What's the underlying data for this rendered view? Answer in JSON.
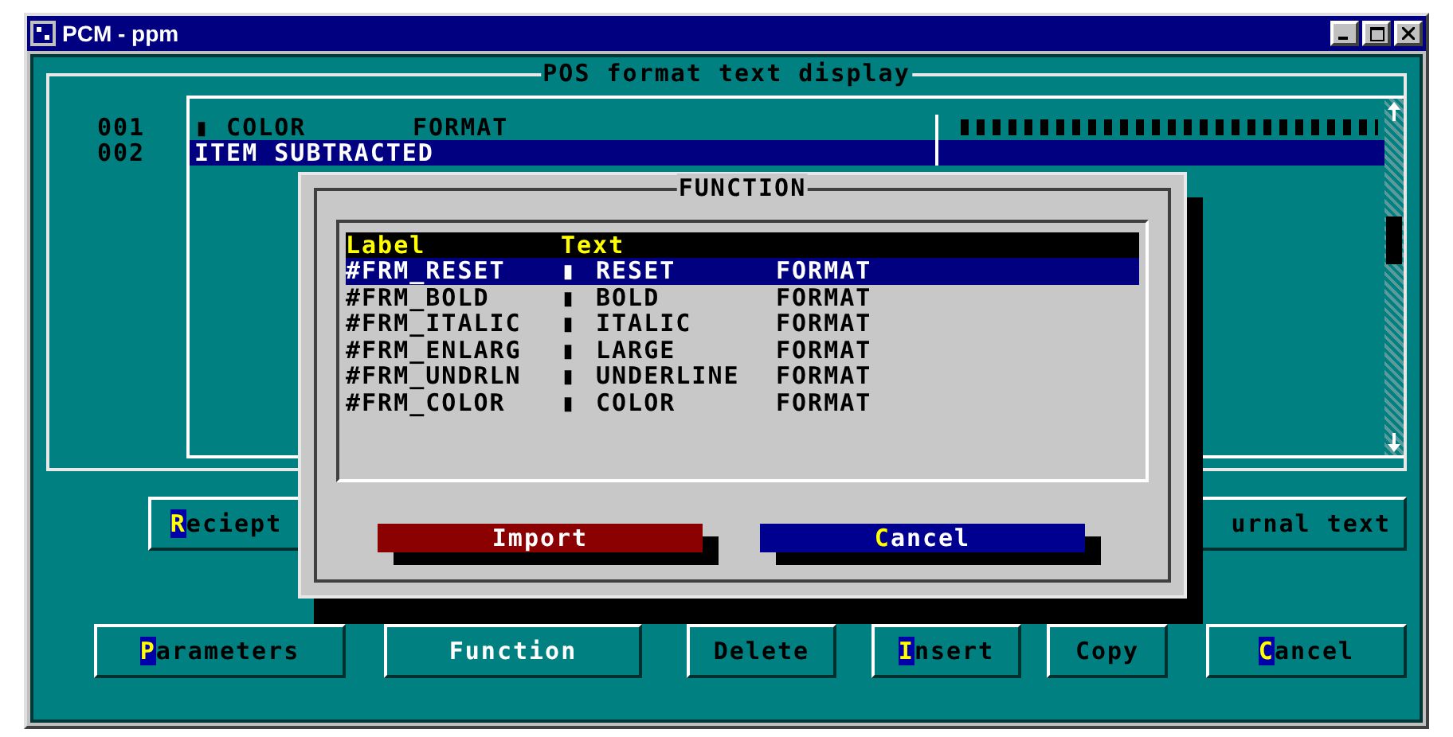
{
  "window": {
    "title": "PCM - ppm"
  },
  "group": {
    "title": "POS format text display"
  },
  "lines": [
    {
      "number": "001",
      "cells": [
        "▮ COLOR",
        "FORMAT"
      ],
      "selected": false
    },
    {
      "number": "002",
      "cells": [
        "ITEM SUBTRACTED"
      ],
      "selected": true
    }
  ],
  "row_buttons": [
    {
      "hotkey": "R",
      "label": "eciept"
    },
    {
      "label": "urnal text"
    }
  ],
  "buttons": [
    {
      "hotkey": "P",
      "label": "arameters"
    },
    {
      "label": "Function"
    },
    {
      "label": "Delete"
    },
    {
      "hotkey": "I",
      "label": "nsert"
    },
    {
      "label": "Copy"
    },
    {
      "hotkey": "C",
      "label": "ancel"
    }
  ],
  "dialog": {
    "title": "FUNCTION",
    "columns": [
      "Label",
      "Text"
    ],
    "rows": [
      {
        "label": "#FRM_RESET",
        "mark": "▮",
        "text": "RESET",
        "format": "FORMAT",
        "selected": true
      },
      {
        "label": "#FRM_BOLD",
        "mark": "▮",
        "text": "BOLD",
        "format": "FORMAT",
        "selected": false
      },
      {
        "label": "#FRM_ITALIC",
        "mark": "▮",
        "text": "ITALIC",
        "format": "FORMAT",
        "selected": false
      },
      {
        "label": "#FRM_ENLARG",
        "mark": "▮",
        "text": "LARGE",
        "format": "FORMAT",
        "selected": false
      },
      {
        "label": "#FRM_UNDRLN",
        "mark": "▮",
        "text": "UNDERLINE",
        "format": "FORMAT",
        "selected": false
      },
      {
        "label": "#FRM_COLOR",
        "mark": "▮",
        "text": "COLOR",
        "format": "FORMAT",
        "selected": false
      }
    ],
    "buttons": [
      {
        "kind": "import",
        "label": "Import"
      },
      {
        "kind": "cancel",
        "hotkey": "C",
        "label": "ancel"
      }
    ]
  }
}
